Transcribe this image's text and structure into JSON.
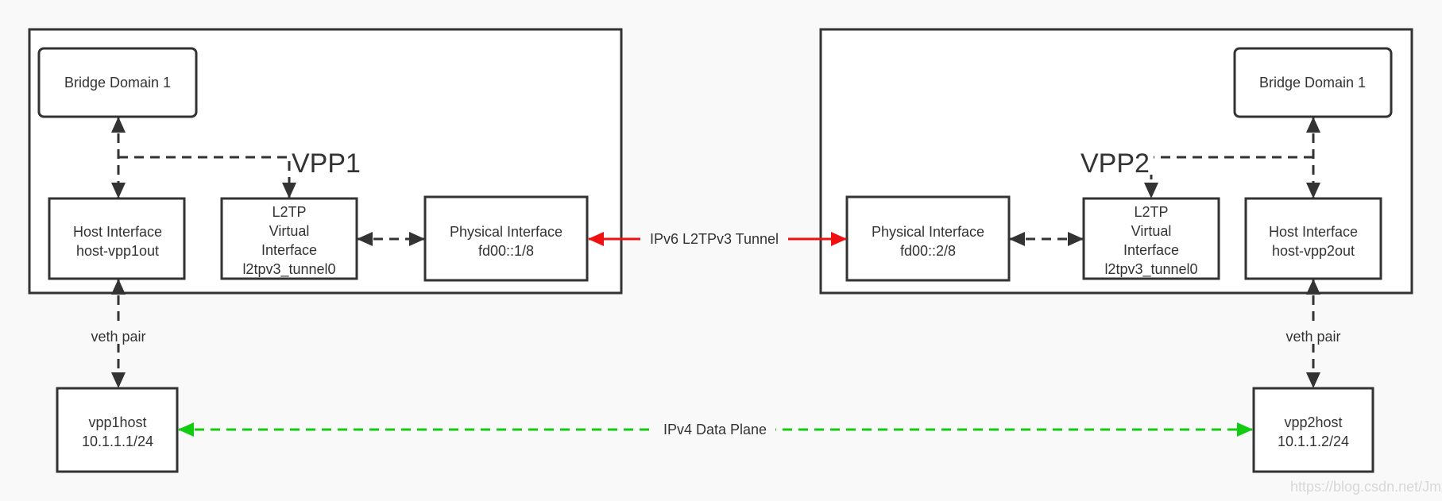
{
  "colors": {
    "line": "#333333",
    "tunnel": "#ee1111",
    "data_plane": "#11cc11",
    "background": "#f9f9f9",
    "box_fill": "#ffffff"
  },
  "vpp1": {
    "label": "VPP1",
    "bridge_domain": "Bridge Domain 1",
    "host_interface": [
      "Host Interface",
      "host-vpp1out"
    ],
    "l2tp_interface": [
      "L2TP",
      "Virtual",
      "Interface",
      "l2tpv3_tunnel0"
    ],
    "physical_interface": [
      "Physical Interface",
      "fd00::1/8"
    ]
  },
  "vpp2": {
    "label": "VPP2",
    "bridge_domain": "Bridge Domain 1",
    "host_interface": [
      "Host Interface",
      "host-vpp2out"
    ],
    "l2tp_interface": [
      "L2TP",
      "Virtual",
      "Interface",
      "l2tpv3_tunnel0"
    ],
    "physical_interface": [
      "Physical Interface",
      "fd00::2/8"
    ]
  },
  "hosts": {
    "vpp1host": [
      "vpp1host",
      "10.1.1.1/24"
    ],
    "vpp2host": [
      "vpp2host",
      "10.1.1.2/24"
    ]
  },
  "links": {
    "tunnel": "IPv6 L2TPv3 Tunnel",
    "data_plane": "IPv4 Data Plane",
    "veth_left": "veth pair",
    "veth_right": "veth pair"
  },
  "watermark": "https://blog.csdn.net/Jmilk"
}
